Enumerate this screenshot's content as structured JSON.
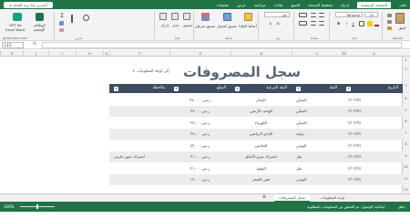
{
  "ribbon_tabs": [
    "ملف",
    "الصفحة الرئيسية",
    "إدراج",
    "تخطيط الصفحة",
    "الصيغ",
    "بيانات",
    "مراجعة",
    "عرض",
    "تعليمات"
  ],
  "ribbon_search": "أخبرني بما تريد القيام به",
  "ribbon": {
    "font_name": "Tahoma",
    "font_size": "10",
    "paste": "لصق",
    "groups": [
      "الحافظة",
      "خط",
      "محاذاة",
      "رقم",
      "أنماط",
      "خلايا",
      "تحرير"
    ],
    "conditional": "تنسيق شرطي",
    "format_table": "تنسيق كجدول",
    "cell_styles": "أنماط الخلايا",
    "number_format": "عام",
    "insert": "إدراج",
    "delete": "حذف",
    "format": "تنسيق",
    "addins": "الوظائف الإضافية",
    "gpt_line1": "GPT for",
    "gpt_line2": "Excel Word",
    "gpt_site": "gptforwork.com"
  },
  "name_box": "L11",
  "columns": [
    "A",
    "B",
    "C",
    "D",
    "E",
    "F",
    "G",
    "H",
    "I",
    "J",
    "K"
  ],
  "rows": [
    "1",
    "2",
    "3",
    "4",
    "5",
    "6",
    "7",
    "8",
    "9",
    "10",
    "11",
    "12"
  ],
  "sheet": {
    "title": "سجل المصروفات",
    "back_link": "< إلى لوحة المعلومات",
    "headers": [
      "التاريخ",
      "الفئة",
      "الفئة الفرعية",
      "المبلغ",
      "ملاحظة"
    ],
    "data": [
      [
        "٠٢/٠٢/٢٤",
        "السكن",
        "الإيجار",
        "ر.س. ٢٩,٠٠٠",
        ""
      ],
      [
        "٠٢/٠٢/٢٤",
        "السكن",
        "الهاتف الأرضي",
        "ر.س. ٢٩,٠٠",
        ""
      ],
      [
        "٠٢/٠٢/٢٤",
        "السكن",
        "الكهرباء",
        "ر.س. ٢٩,٠٠",
        ""
      ],
      [
        "٠٢/٠٢/٢٤",
        "ترفيه",
        "النادي الرياضي",
        "ر.س. ٢٩,٠٠",
        ""
      ],
      [
        "٠٢/٠٢/٢٤",
        "اليومي",
        "الملابس",
        "ر.س. ٤٢,٠٠",
        ""
      ],
      [
        "٠٢/٠٢/٢٤",
        "نقل",
        "اشتراك مترو الأنفاق",
        "ر.س. ٢١,٠٠",
        "اشتراك شهر مارس"
      ],
      [
        "٠٢/٠٢/٢٤",
        "نقل",
        "الوقود",
        "ر.س. ٢١,٠٠",
        ""
      ],
      [
        "٠٢/٠٢/٢٤",
        "اليومي",
        "قص الشعر",
        "ر.س. ١٢,٠٠",
        ""
      ]
    ]
  },
  "sheet_tabs": [
    "لوحة المعلومات",
    "سجل المصروفات"
  ],
  "status": {
    "left": "جاهز",
    "accessibility": "إمكانية الوصول: تم التحقق من المعلومات المطلوبة",
    "zoom": "100%"
  }
}
